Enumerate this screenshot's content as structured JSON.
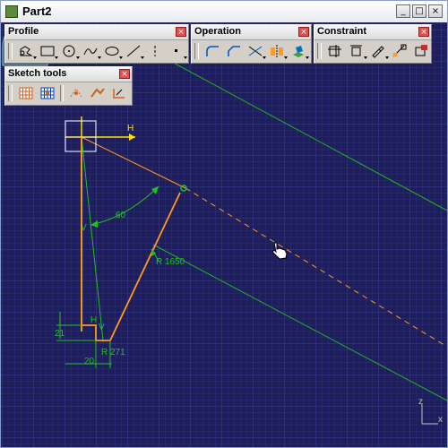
{
  "window": {
    "title": "Part2",
    "minimize_glyph": "_",
    "maximize_glyph": "□",
    "close_glyph": "×"
  },
  "toolbars": {
    "profile": {
      "title": "Profile",
      "close_glyph": "×"
    },
    "operation": {
      "title": "Operation",
      "close_glyph": "×"
    },
    "constraint": {
      "title": "Constraint",
      "close_glyph": "×"
    },
    "sketch_tools": {
      "title": "Sketch tools",
      "close_glyph": "×"
    }
  },
  "sketch": {
    "axis_h_label": "H",
    "axis_v_label": "V",
    "angle_label": "60",
    "radius_label": "R 1650",
    "radius_small_label": "R 271",
    "dim_vertical_label": "21",
    "dim_horizontal_label": "20",
    "corner_h_label": "H",
    "corner_v_label": "V"
  },
  "compass": {
    "z_label": "z",
    "y_label": "y",
    "x_label": "x"
  },
  "axis_triad": {
    "z_label": "z",
    "x_label": "x"
  },
  "colors": {
    "background": "#1e1f5a",
    "grid": "#2a2c78",
    "sketch_green": "#20c020",
    "profile_orange": "#ff9a20",
    "axis_yellow": "#ffe000"
  }
}
